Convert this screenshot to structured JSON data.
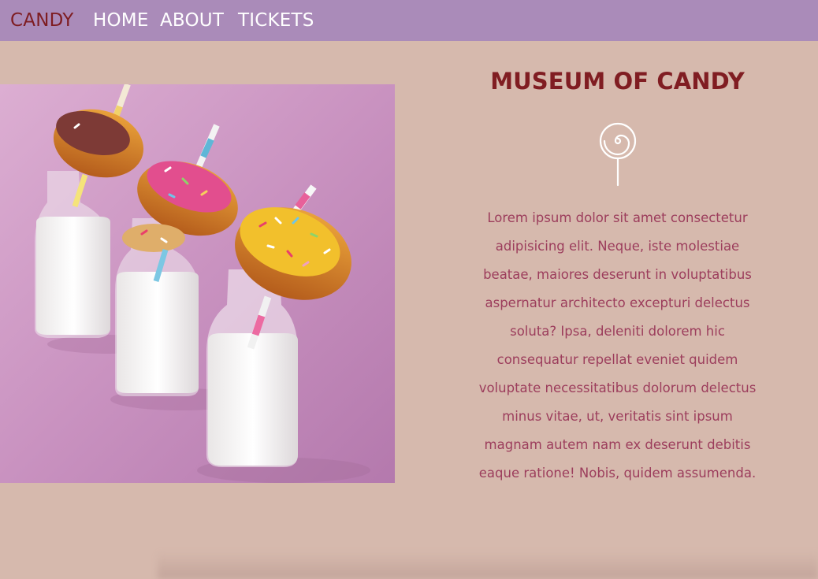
{
  "nav": {
    "brand": "CANDY",
    "links": [
      "HOME",
      "ABOUT",
      "TICKETS"
    ]
  },
  "hero": {
    "title": "MUSEUM OF CANDY",
    "icon": "lollipop-icon",
    "description": "Lorem ipsum dolor sit amet consectetur adipisicing elit. Neque, iste molestiae beatae, maiores deserunt in voluptatibus aspernatur architecto excepturi delectus soluta? Ipsa, deleniti dolorem hic consequatur repellat eveniet quidem voluptate necessitatibus dolorum delectus minus vitae, ut, veritatis sint ipsum magnam autem nam ex deserunt debitis eaque ratione! Nobis, quidem assumenda."
  },
  "colors": {
    "navbar": "#aa8bb9",
    "background": "#d6b9ad",
    "brand": "#7e1d22",
    "title": "#801d22",
    "body_text": "#9c3d5c",
    "nav_link": "#ffffff"
  }
}
